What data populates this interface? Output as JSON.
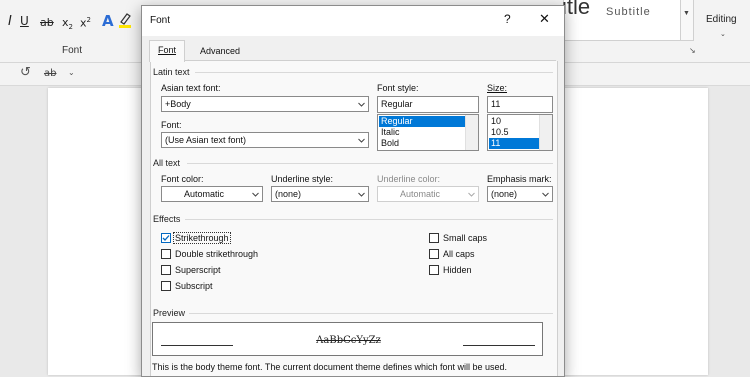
{
  "word": {
    "ribbon_group_label": "Font",
    "style_gallery_item": "Subtitle",
    "editing_label": "Editing",
    "style_fragment": "itle"
  },
  "dialog": {
    "title": "Font",
    "help_glyph": "?",
    "close_glyph": "✕",
    "tabs": [
      {
        "label": "Font",
        "active": true
      },
      {
        "label": "Advanced",
        "active": false
      }
    ],
    "latin_text": {
      "section_label": "Latin text",
      "asian_font_label": "Asian text font:",
      "asian_font_value": "+Body",
      "font_label": "Font:",
      "font_value": "(Use Asian text font)",
      "style_label": "Font style:",
      "style_value": "Regular",
      "style_options": [
        {
          "label": "Regular",
          "selected": true
        },
        {
          "label": "Italic",
          "selected": false
        },
        {
          "label": "Bold",
          "selected": false
        }
      ],
      "size_label": "Size:",
      "size_value": "11",
      "size_options": [
        {
          "label": "10",
          "selected": false
        },
        {
          "label": "10.5",
          "selected": false
        },
        {
          "label": "11",
          "selected": true
        }
      ]
    },
    "all_text": {
      "section_label": "All text",
      "font_color_label": "Font color:",
      "font_color_value": "Automatic",
      "underline_style_label": "Underline style:",
      "underline_style_value": "(none)",
      "underline_color_label": "Underline color:",
      "underline_color_value": "Automatic",
      "emphasis_mark_label": "Emphasis mark:",
      "emphasis_mark_value": "(none)"
    },
    "effects": {
      "section_label": "Effects",
      "left": [
        {
          "label": "Strikethrough",
          "checked": true
        },
        {
          "label": "Double strikethrough",
          "checked": false
        },
        {
          "label": "Superscript",
          "checked": false
        },
        {
          "label": "Subscript",
          "checked": false
        }
      ],
      "right": [
        {
          "label": "Small caps",
          "checked": false
        },
        {
          "label": "All caps",
          "checked": false
        },
        {
          "label": "Hidden",
          "checked": false
        }
      ]
    },
    "preview": {
      "section_label": "Preview",
      "sample": "AaBbCcYyZz",
      "description": "This is the body theme font. The current document theme defines which font will be used."
    }
  },
  "colors": {
    "accent": "#0078d7",
    "checkbox_mark": "#0067c0",
    "highlight_yellow": "#ffe600",
    "font_color_blue": "#2b6cd4"
  }
}
